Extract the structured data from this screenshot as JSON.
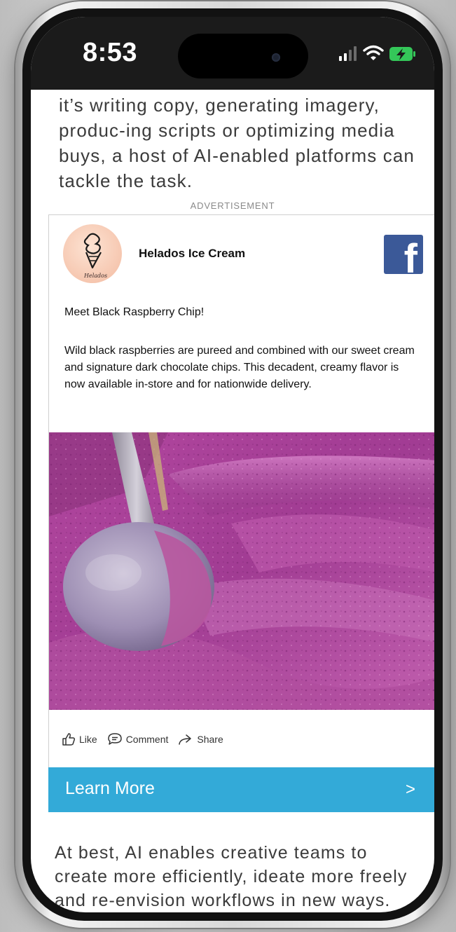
{
  "status_bar": {
    "time": "8:53"
  },
  "article": {
    "intro_text": "it’s writing copy, generating imagery, produc-ing scripts or optimizing media buys, a host of AI-enabled platforms can tackle the task.",
    "closing_text": "At best, AI enables creative teams to create more efficiently, ideate more freely and re-envision workflows in new ways."
  },
  "ad": {
    "label": "ADVERTISEMENT",
    "advertiser": "Helados Ice Cream",
    "logo_script": "Helados",
    "headline": "Meet Black Raspberry Chip!",
    "body": "Wild black raspberries are pureed and combined with our sweet cream and signature dark chocolate chips. This decadent, creamy flavor is now available in-store and for nationwide delivery.",
    "actions": {
      "like": "Like",
      "comment": "Comment",
      "share": "Share"
    },
    "cta": {
      "label": "Learn More",
      "chevron": ">"
    }
  },
  "icons": {
    "platform": "facebook-logo-icon",
    "signal": "cellular-signal-icon",
    "wifi": "wifi-icon",
    "battery": "battery-charging-icon"
  },
  "colors": {
    "cta_background": "#33aad8",
    "facebook_blue": "#3b5998",
    "battery_green": "#34c759",
    "ice_cream": "#a43f96"
  }
}
